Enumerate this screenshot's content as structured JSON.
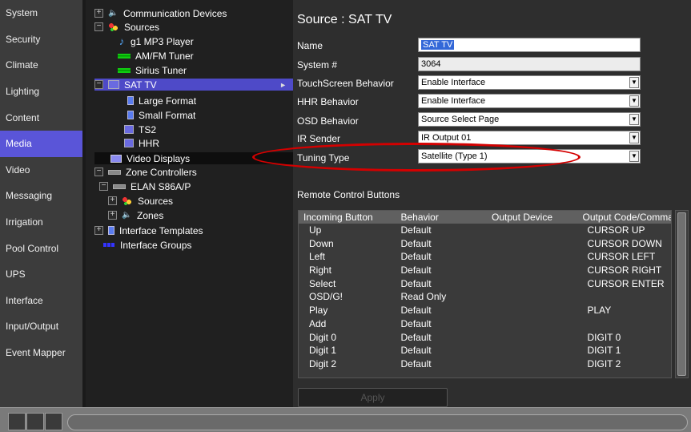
{
  "nav": {
    "items": [
      {
        "label": "System",
        "active": false
      },
      {
        "label": "Security",
        "active": false
      },
      {
        "label": "Climate",
        "active": false
      },
      {
        "label": "Lighting",
        "active": false
      },
      {
        "label": "Content",
        "active": false
      },
      {
        "label": "Media",
        "active": true
      },
      {
        "label": "Video",
        "active": false
      },
      {
        "label": "Messaging",
        "active": false
      },
      {
        "label": "Irrigation",
        "active": false
      },
      {
        "label": "Pool Control",
        "active": false
      },
      {
        "label": "UPS",
        "active": false
      },
      {
        "label": "Interface",
        "active": false
      },
      {
        "label": "Input/Output",
        "active": false
      },
      {
        "label": "Event Mapper",
        "active": false
      }
    ]
  },
  "tree": {
    "communication_devices": "Communication Devices",
    "sources": "Sources",
    "g1_mp3": "g1 MP3 Player",
    "am_fm": "AM/FM Tuner",
    "sirius": "Sirius Tuner",
    "sat_tv": "SAT TV",
    "large_format": "Large Format",
    "small_format": "Small Format",
    "ts2": "TS2",
    "hhr": "HHR",
    "video_displays": "Video Displays",
    "zone_controllers": "Zone Controllers",
    "elan": "ELAN S86A/P",
    "elan_sources": "Sources",
    "elan_zones": "Zones",
    "interface_templates": "Interface Templates",
    "interface_groups": "Interface Groups"
  },
  "detail": {
    "title": "Source : SAT TV",
    "name_label": "Name",
    "name_value": "SAT TV",
    "system_label": "System #",
    "system_value": "3064",
    "touch_label": "TouchScreen Behavior",
    "touch_value": "Enable Interface",
    "hhr_label": "HHR Behavior",
    "hhr_value": "Enable Interface",
    "osd_label": "OSD Behavior",
    "osd_value": "Source Select Page",
    "ir_label": "IR Sender",
    "ir_value": "IR Output 01",
    "tuning_label": "Tuning Type",
    "tuning_value": "Satellite (Type 1)",
    "rcb_title": "Remote Control Buttons",
    "apply_label": "Apply"
  },
  "buttons_table": {
    "headers": [
      "Incoming Button",
      "Behavior",
      "Output Device",
      "Output Code/Comma"
    ],
    "rows": [
      [
        "Up",
        "Default",
        "",
        "CURSOR UP"
      ],
      [
        "Down",
        "Default",
        "",
        "CURSOR DOWN"
      ],
      [
        "Left",
        "Default",
        "",
        "CURSOR LEFT"
      ],
      [
        "Right",
        "Default",
        "",
        "CURSOR RIGHT"
      ],
      [
        "Select",
        "Default",
        "",
        "CURSOR ENTER"
      ],
      [
        "OSD/G!",
        "Read Only",
        "",
        ""
      ],
      [
        "Play",
        "Default",
        "",
        "PLAY"
      ],
      [
        "Add",
        "Default",
        "",
        ""
      ],
      [
        "Digit 0",
        "Default",
        "",
        "DIGIT 0"
      ],
      [
        "Digit 1",
        "Default",
        "",
        "DIGIT 1"
      ],
      [
        "Digit 2",
        "Default",
        "",
        "DIGIT 2"
      ]
    ]
  },
  "tree_toggles": {
    "plus": "+",
    "minus": "−"
  },
  "glyphs": {
    "expand_arrow": "►",
    "combo_arrow": "▼",
    "music": "♪",
    "speaker": "🔈"
  },
  "colors": {
    "selection": "#4e4ac8",
    "nav_active": "#5a55d8",
    "annotation": "#d40000"
  }
}
